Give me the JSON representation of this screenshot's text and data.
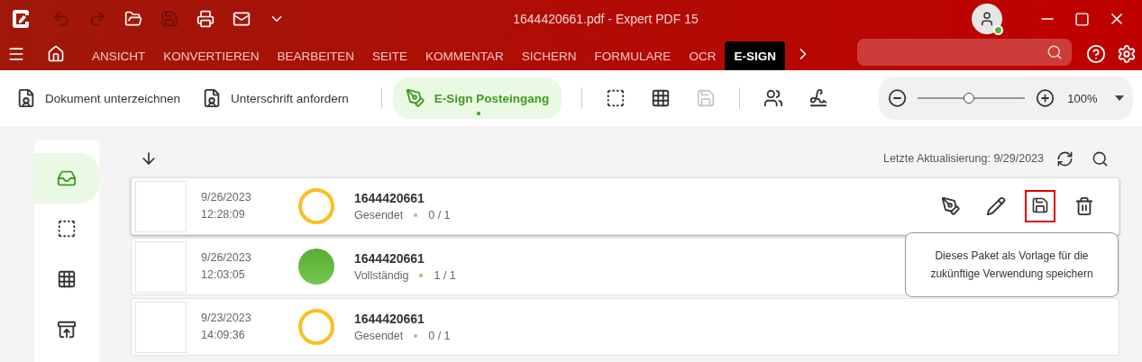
{
  "window": {
    "title": "1644420661.pdf  -  Expert PDF 15",
    "user_online": true
  },
  "ribbon_tabs": [
    {
      "label": "ANSICHT",
      "selected": false
    },
    {
      "label": "KONVERTIEREN",
      "selected": false
    },
    {
      "label": "BEARBEITEN",
      "selected": false
    },
    {
      "label": "SEITE",
      "selected": false
    },
    {
      "label": "KOMMENTAR",
      "selected": false
    },
    {
      "label": "SICHERN",
      "selected": false
    },
    {
      "label": "FORMULARE",
      "selected": false
    },
    {
      "label": "OCR",
      "selected": false
    },
    {
      "label": "E-SIGN",
      "selected": true
    }
  ],
  "toolbar": {
    "actions": [
      {
        "label": "Dokument unterzeichnen",
        "selected": false
      },
      {
        "label": "Unterschrift anfordern",
        "selected": false
      },
      {
        "label": "E-Sign Posteingang",
        "selected": true
      }
    ],
    "tools": [
      {
        "disabled": false
      },
      {
        "disabled": false
      },
      {
        "disabled": true
      },
      {
        "disabled": false
      },
      {
        "disabled": false
      }
    ],
    "zoom": {
      "level": 0.48,
      "reading": "100%"
    }
  },
  "sidebar": {
    "items": [
      {
        "selected": true
      },
      {
        "selected": false
      },
      {
        "selected": false
      },
      {
        "selected": false
      }
    ]
  },
  "inbox": {
    "last_update": "Letzte Aktualisierung: 9/29/2023",
    "packages": [
      {
        "date": "9/26/2023",
        "time": "12:28:09",
        "kind": "sent",
        "name": "1644420661",
        "status": "Gesendet",
        "count": "0 / 1",
        "hovered": true
      },
      {
        "date": "9/26/2023",
        "time": "12:03:05",
        "kind": "complete",
        "name": "1644420661",
        "status": "Vollständig",
        "count": "1 / 1",
        "hovered": false
      },
      {
        "date": "9/23/2023",
        "time": "14:09:36",
        "kind": "sent",
        "name": "1644420661",
        "status": "Gesendet",
        "count": "0 / 1",
        "hovered": false
      }
    ],
    "tooltip": "Dieses Paket als Vorlage für die zukünftige Verwendung speichern"
  }
}
